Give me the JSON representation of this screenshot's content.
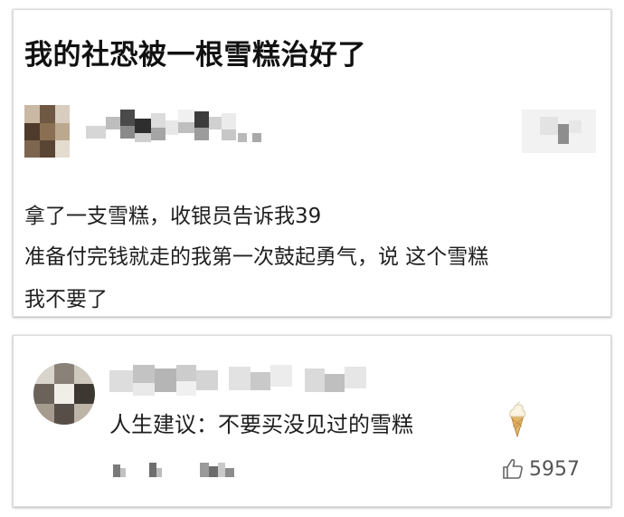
{
  "post": {
    "title": "我的社恐被一根雪糕治好了",
    "lines": [
      "拿了一支雪糕，收银员告诉我39",
      "准备付完钱就走的我第一次鼓起勇气，说 这个雪糕",
      "我不要了"
    ]
  },
  "comment": {
    "text": "人生建议：不要买没见过的雪糕",
    "emoji_icon": "ice-cream-icon",
    "likes": "5957",
    "like_icon": "thumbs-up-icon"
  },
  "colors": {
    "card_border": "#dcdcdc",
    "text": "#1f1f1f",
    "muted": "#555555"
  }
}
